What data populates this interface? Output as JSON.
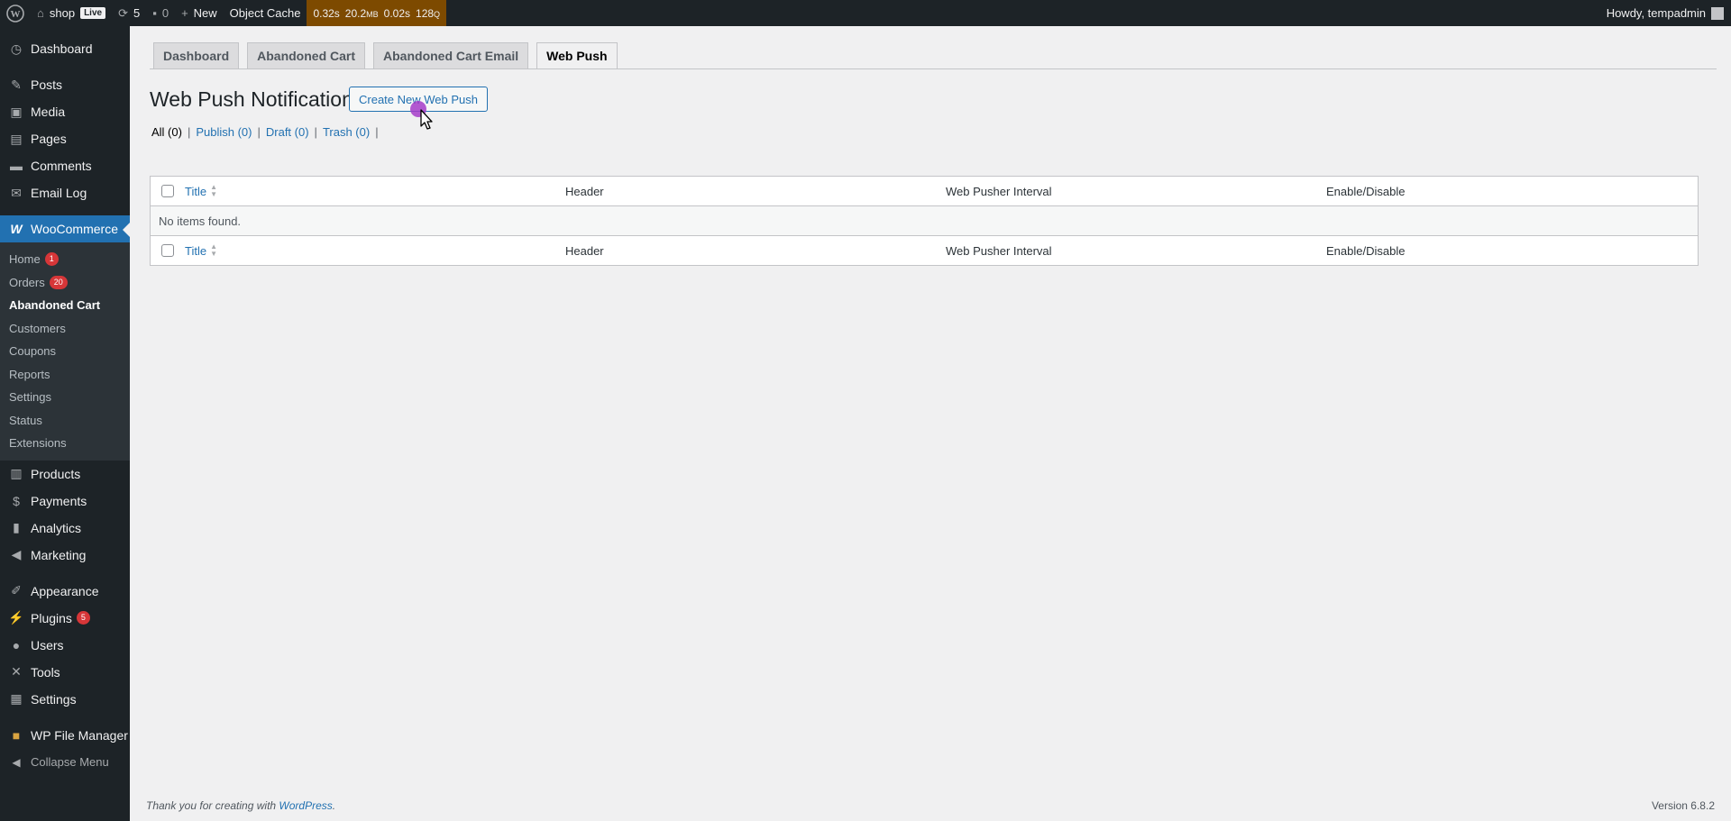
{
  "adminbar": {
    "site_name": "shop",
    "live_label": "Live",
    "updates_count": "5",
    "comments_count": "0",
    "new_label": "New",
    "object_cache_label": "Object Cache",
    "qm": {
      "time": "0.32s",
      "memory": "20.2",
      "memory_unit": "MB",
      "db_time": "0.02s",
      "queries": "128",
      "queries_unit": "Q"
    },
    "howdy": "Howdy, tempadmin"
  },
  "sidebar": {
    "items_top": [
      {
        "label": "Dashboard",
        "icon": "dashboard-icon"
      },
      {
        "label": "Posts",
        "icon": "pin-icon"
      },
      {
        "label": "Media",
        "icon": "media-icon"
      },
      {
        "label": "Pages",
        "icon": "pages-icon"
      },
      {
        "label": "Comments",
        "icon": "comments-icon"
      },
      {
        "label": "Email Log",
        "icon": "email-icon"
      }
    ],
    "woocommerce": {
      "label": "WooCommerce",
      "icon": "woo-icon"
    },
    "woo_sub": [
      {
        "label": "Home",
        "badge": "1"
      },
      {
        "label": "Orders",
        "badge": "20"
      },
      {
        "label": "Abandoned Cart"
      },
      {
        "label": "Customers"
      },
      {
        "label": "Coupons"
      },
      {
        "label": "Reports"
      },
      {
        "label": "Settings"
      },
      {
        "label": "Status"
      },
      {
        "label": "Extensions"
      }
    ],
    "items_mid": [
      {
        "label": "Products"
      },
      {
        "label": "Payments"
      },
      {
        "label": "Analytics"
      },
      {
        "label": "Marketing"
      }
    ],
    "items_bottom": [
      {
        "label": "Appearance"
      },
      {
        "label": "Plugins",
        "badge": "5"
      },
      {
        "label": "Users"
      },
      {
        "label": "Tools"
      },
      {
        "label": "Settings"
      }
    ],
    "file_manager": "WP File Manager",
    "collapse": "Collapse Menu"
  },
  "tabs": [
    {
      "label": "Dashboard"
    },
    {
      "label": "Abandoned Cart"
    },
    {
      "label": "Abandoned Cart Email"
    },
    {
      "label": "Web Push"
    }
  ],
  "page": {
    "title": "Web Push Notifications",
    "action": "Create New Web Push"
  },
  "filters": {
    "all": "All (0)",
    "publish": "Publish (0)",
    "draft": "Draft (0)",
    "trash": "Trash (0)",
    "sep": "|"
  },
  "table": {
    "columns": [
      "Title",
      "Header",
      "Web Pusher Interval",
      "Enable/Disable"
    ],
    "empty": "No items found."
  },
  "footer": {
    "thanks_prefix": "Thank you for creating with ",
    "thanks_link": "WordPress",
    "thanks_suffix": ".",
    "version": "Version 6.8.2"
  },
  "colors": {
    "accent": "#2271b1",
    "admin_dark": "#1d2327",
    "badge": "#d63638",
    "qm": "#7d4a00"
  }
}
